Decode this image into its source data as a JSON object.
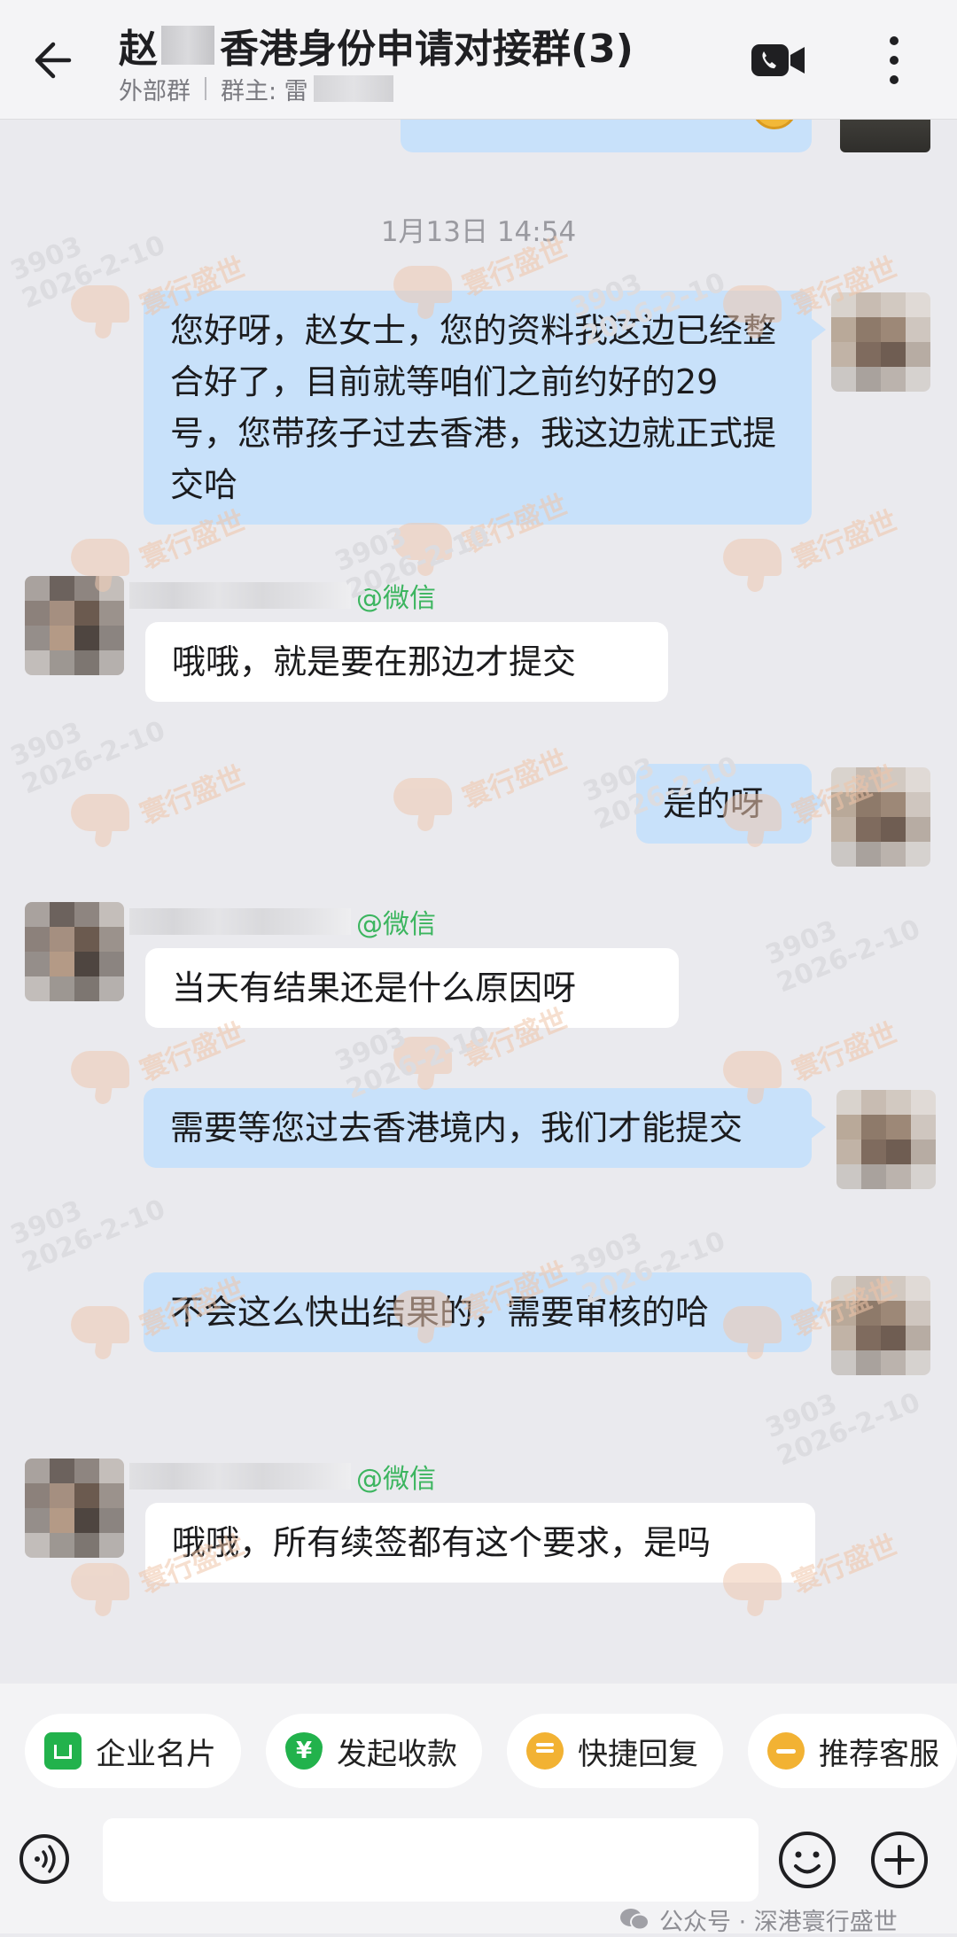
{
  "header": {
    "title_prefix": "赵",
    "title_main": "香港身份申请对接群(3)",
    "group_type": "外部群",
    "owner_label": "群主: 雷"
  },
  "watermark": {
    "brand": "寰行盛世",
    "code": "3903",
    "date": "2026-2-10"
  },
  "chat": {
    "timestamp": "1月13日  14:54",
    "sender_tag": "@微信",
    "messages": [
      {
        "direction": "out",
        "text": "您好呀，赵女士，您的资料我这边已经整合好了，目前就等咱们之前约好的29号，您带孩子过去香港，我这边就正式提交哈"
      },
      {
        "direction": "in",
        "text": "哦哦，就是要在那边才提交"
      },
      {
        "direction": "out",
        "text": "是的呀"
      },
      {
        "direction": "in",
        "text": "当天有结果还是什么原因呀"
      },
      {
        "direction": "out",
        "text": "需要等您过去香港境内，我们才能提交"
      },
      {
        "direction": "out",
        "text": "不会这么快出结果的，需要审核的哈"
      },
      {
        "direction": "in",
        "text": "哦哦，所有续签都有这个要求，是吗"
      }
    ]
  },
  "quick_actions": [
    {
      "label": "企业名片",
      "icon": "business-card-icon",
      "color": "#22b24c"
    },
    {
      "label": "发起收款",
      "icon": "payment-icon",
      "color": "#22b24c"
    },
    {
      "label": "快捷回复",
      "icon": "quick-reply-icon",
      "color": "#f2b233"
    },
    {
      "label": "推荐客服",
      "icon": "recommend-service-icon",
      "color": "#f2b233"
    }
  ],
  "source_label": "公众号 · 深港寰行盛世"
}
